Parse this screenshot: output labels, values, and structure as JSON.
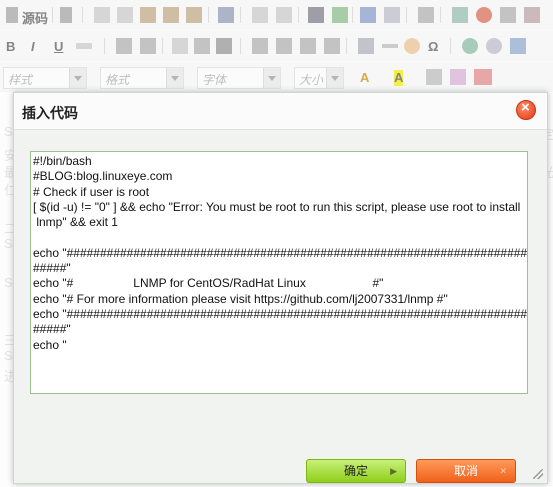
{
  "toolbar": {
    "source_label": "源码",
    "styles_label": "样式",
    "format_label": "格式",
    "font_label": "字体",
    "size_label": "大小"
  },
  "background": {
    "line_s": "S",
    "line_an": "安",
    "line_zui": "最",
    "line_ren": "仁",
    "line_er": "二",
    "line_san": "三",
    "line_jin": "进",
    "right_ding": "定",
    "right_guang": "光"
  },
  "dialog": {
    "title": "插入代码",
    "code_lines": [
      "#!/bin/bash",
      "#BLOG:blog.linuxeye.com",
      "# Check if user is root",
      "[ $(id -u) != \"0\" ] && echo \"Error: You must be root to run this script, please use root to install",
      " lnmp\" && exit 1",
      "",
      "echo \"#######################################################################",
      "#####\"",
      "echo \"#                  LNMP for CentOS/RadHat Linux                    #\"",
      "echo \"# For more information please visit https://github.com/lj2007331/lnmp #\"",
      "echo \"#######################################################################",
      "#####\"",
      "echo \""
    ],
    "ok_label": "确定",
    "cancel_label": "取消"
  },
  "colors": {
    "ok": "#8fcf1a",
    "cancel": "#f0601a",
    "close": "#e23a10",
    "editor_border": "#9fbf8f"
  }
}
